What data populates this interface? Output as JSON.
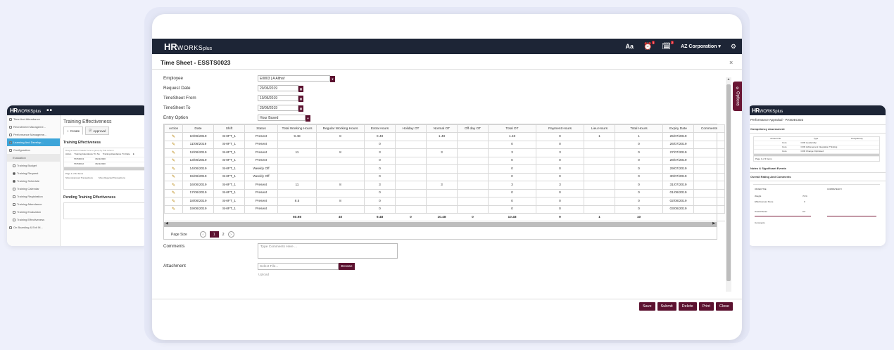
{
  "left_card": {
    "logo_hr": "HR",
    "logo_works": "WORKSplus",
    "nav": [
      {
        "label": "Time And Attendance"
      },
      {
        "label": "Recruitment Manageme..."
      },
      {
        "label": "Performance Manageme..."
      },
      {
        "label": "Learning And Develop..."
      },
      {
        "label": "Configuration"
      },
      {
        "label": "Evaluation"
      },
      {
        "label": "Training Budget"
      },
      {
        "label": "Training Request"
      },
      {
        "label": "Training Schedule"
      },
      {
        "label": "Training Calendar"
      },
      {
        "label": "Training Registration"
      },
      {
        "label": "Training Attendance"
      },
      {
        "label": "Training Evaluation"
      },
      {
        "label": "Training Effectiveness"
      },
      {
        "label": "On Boarding & Exit M..."
      }
    ],
    "page_title": "Training Effectiveness",
    "tabs": [
      "Create",
      "Approval"
    ],
    "section1": "Training Effectiveness",
    "drag_hint": "Drag a column header here to group by that column",
    "grid_headers": [
      "Action",
      "Training Attendance Trn No",
      "Training Attendance Trn Date",
      "E"
    ],
    "grid_rows": [
      [
        "TATN0013",
        "16/11/2020"
      ],
      [
        "TATN0012",
        "16/11/2020"
      ]
    ],
    "page_info": "Page 1 of 42 Items",
    "show_approved": "Show Approved Transactions",
    "show_rejected": "Show Rejected Transactions",
    "section2": "Pending Training Effectiveness"
  },
  "right_card": {
    "logo_hr": "HR",
    "logo_works": "WORKSplus",
    "title": "Performance Appraisal - PASDEC022",
    "sec1": "Competency Assessment",
    "table_headers": [
      "Amount No",
      "Type",
      "Competency"
    ],
    "table_rows": [
      [
        "Core",
        "COR Leadership"
      ],
      [
        "Core",
        "COR Achievement Integration Thinking"
      ],
      [
        "Core",
        "COR Change Optimised"
      ]
    ],
    "page_info": "Page 1 of 3 Items",
    "sec2": "Notes & Significant Events",
    "sec3": "Overall Rating And Comments",
    "objective": "OBJECTIVE",
    "competency": "COMPETENCY",
    "weight": "Weight",
    "weight_val": "70 %",
    "effectiveness": "Effectiveness Score",
    "eff_val": "0",
    "overall_score": "Overall Score",
    "overall_val": "0.0",
    "comments": "Comments"
  },
  "topbar": {
    "logo_hr": "HR",
    "logo_works": "WORKS",
    "logo_plus": "plus",
    "aa": "Aa",
    "badge1": "1",
    "badge2": "2",
    "company": "AZ Corporation ▾"
  },
  "modal": {
    "title": "Time Sheet - ESSTS0023",
    "close": "×",
    "options_label": "Options"
  },
  "form": {
    "employee_label": "Employee",
    "employee_value": "E0803 | A Althaf",
    "request_date_label": "Request Date",
    "request_date_value": "20/06/2019",
    "from_label": "TimeSheet From",
    "from_value": "10/06/2019",
    "to_label": "TimeSheet To",
    "to_value": "20/06/2019",
    "entry_option_label": "Entry Option",
    "entry_option_value": "Hour Based"
  },
  "timesheet": {
    "headers": [
      "Action",
      "Date",
      "Shift",
      "Status",
      "Total Working Hours",
      "Regular Working Hours",
      "Extra Hours",
      "Holiday OT",
      "Normal OT",
      "Off day OT",
      "Total OT",
      "Payment Hours",
      "Lieu Hours",
      "Total Hours",
      "Expiry Date",
      "Comments"
    ],
    "rows": [
      [
        "10/06/2019",
        "SHIFT_1",
        "Present",
        "9.48",
        "8",
        "0.48",
        "",
        "1.48",
        "",
        "1.48",
        "0",
        "1",
        "1",
        "25/07/2019",
        ""
      ],
      [
        "11/06/2019",
        "SHIFT_1",
        "Present",
        "",
        "",
        "0",
        "",
        "",
        "",
        "0",
        "0",
        "",
        "0",
        "26/07/2019",
        ""
      ],
      [
        "12/06/2019",
        "SHIFT_1",
        "Present",
        "11",
        "8",
        "3",
        "",
        "3",
        "",
        "3",
        "3",
        "",
        "0",
        "27/07/2019",
        ""
      ],
      [
        "13/06/2019",
        "SHIFT_1",
        "Present",
        "",
        "",
        "0",
        "",
        "",
        "",
        "0",
        "0",
        "",
        "0",
        "28/07/2019",
        ""
      ],
      [
        "14/06/2019",
        "SHIFT_1",
        "Weekly Off",
        "",
        "",
        "0",
        "",
        "",
        "",
        "0",
        "0",
        "",
        "0",
        "29/07/2019",
        ""
      ],
      [
        "15/06/2019",
        "SHIFT_1",
        "Weekly Off",
        "",
        "",
        "0",
        "",
        "",
        "",
        "0",
        "0",
        "",
        "0",
        "30/07/2019",
        ""
      ],
      [
        "16/06/2019",
        "SHIFT_1",
        "Present",
        "11",
        "8",
        "3",
        "",
        "3",
        "",
        "3",
        "3",
        "",
        "0",
        "31/07/2019",
        ""
      ],
      [
        "17/06/2019",
        "SHIFT_1",
        "Present",
        "",
        "",
        "0",
        "",
        "",
        "",
        "0",
        "0",
        "",
        "0",
        "01/08/2019",
        ""
      ],
      [
        "18/06/2019",
        "SHIFT_1",
        "Present",
        "8.5",
        "8",
        "0",
        "",
        "",
        "",
        "0",
        "0",
        "",
        "0",
        "02/08/2019",
        ""
      ],
      [
        "19/06/2019",
        "SHIFT_1",
        "Present",
        "",
        "",
        "0",
        "",
        "",
        "",
        "0",
        "0",
        "",
        "0",
        "03/08/2019",
        ""
      ]
    ],
    "totals": [
      "",
      "",
      "",
      "",
      "50.98",
      "40",
      "9.48",
      "0",
      "10.48",
      "0",
      "10.48",
      "9",
      "1",
      "10",
      "",
      ""
    ],
    "page_size_label": "Page Size",
    "pages": [
      "1",
      "2"
    ]
  },
  "comments": {
    "label": "Comments",
    "placeholder": "Type Comments Here ..."
  },
  "attachment": {
    "label": "Attachment",
    "placeholder": "Select File...",
    "browse": "Browse",
    "upload": "Upload"
  },
  "buttons": {
    "save": "Save",
    "submit": "Submit",
    "delete": "Delete",
    "print": "Print",
    "close": "Close"
  },
  "colors": {
    "topbar": "#1d2536",
    "accent": "#5c1230",
    "nav_active": "#3da5d9"
  }
}
